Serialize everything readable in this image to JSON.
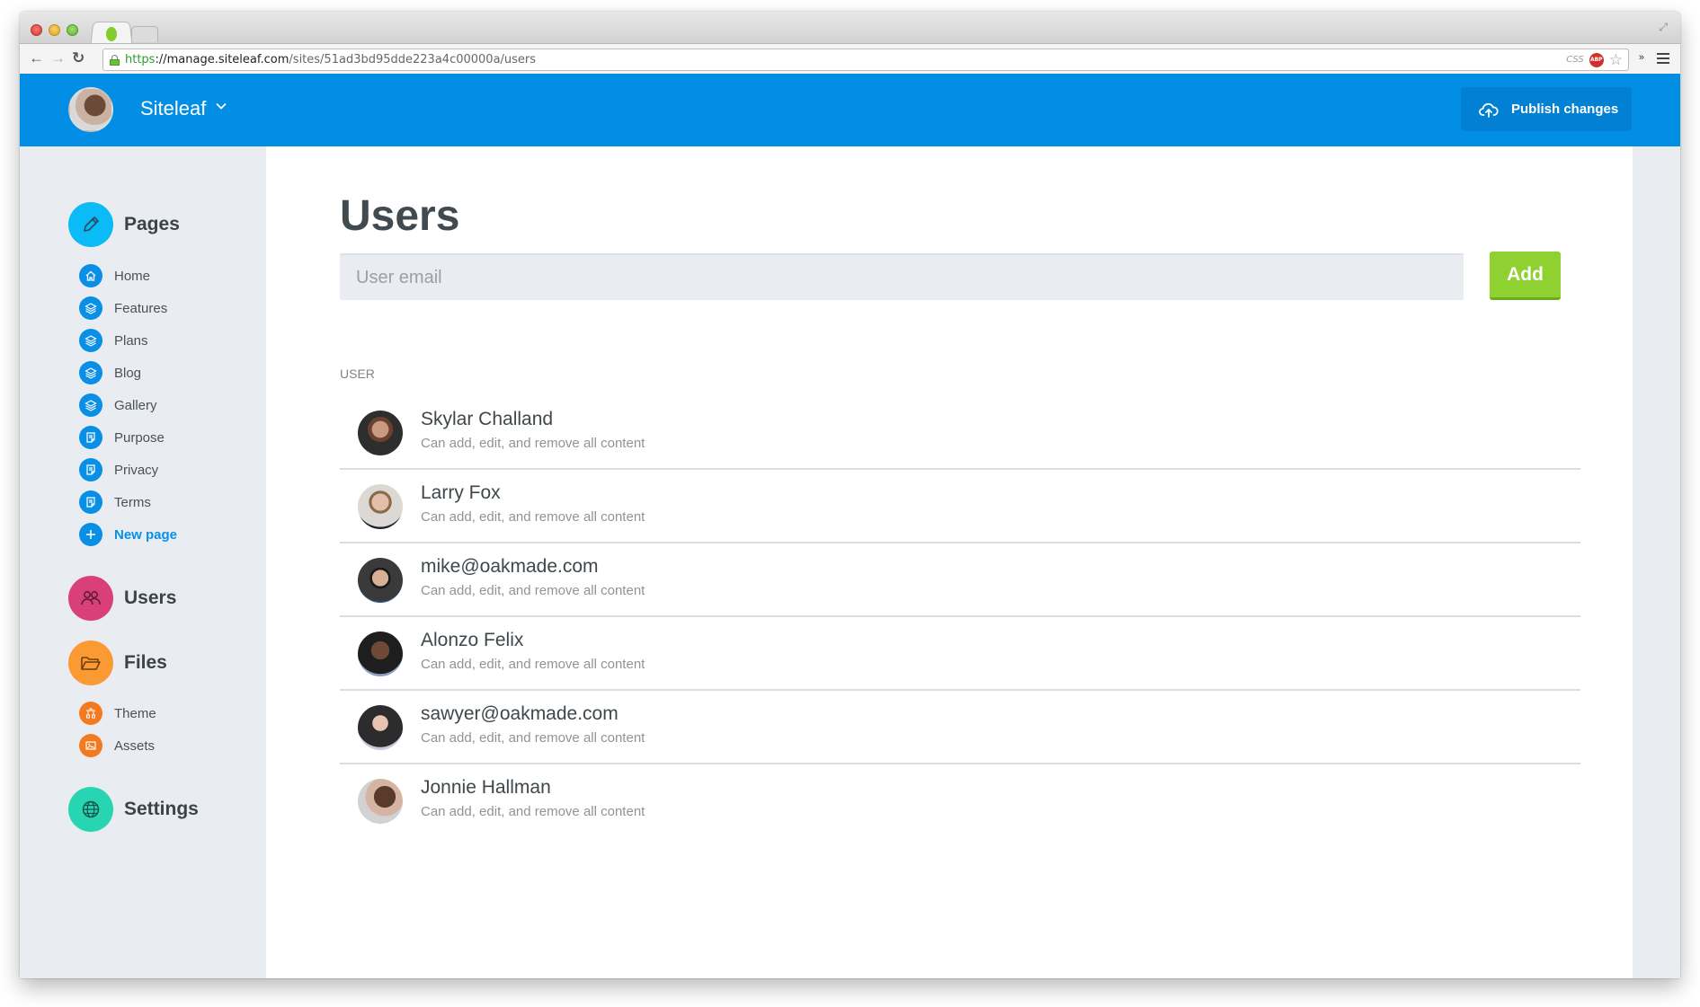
{
  "browser": {
    "url_scheme": "https",
    "url_host": "://manage.siteleaf.com",
    "url_path": "/sites/51ad3bd95dde223a4c00000a/users",
    "extension_css_label": "CSS",
    "extension_abp_label": "ABP"
  },
  "header": {
    "site_name": "Siteleaf",
    "publish_label": "Publish changes",
    "colors": {
      "header_bg": "#038ee6",
      "publish_bg": "#0280d4"
    }
  },
  "sidebar": {
    "sections": [
      {
        "label": "Pages",
        "icon": "pencil-icon",
        "color": "#0abbf7"
      },
      {
        "label": "Users",
        "icon": "users-icon",
        "color": "#d9407a"
      },
      {
        "label": "Files",
        "icon": "folder-icon",
        "color": "#fb9a32"
      },
      {
        "label": "Settings",
        "icon": "globe-icon",
        "color": "#27d5b3"
      }
    ],
    "pages": [
      {
        "label": "Home",
        "icon": "home-icon"
      },
      {
        "label": "Features",
        "icon": "layers-icon"
      },
      {
        "label": "Plans",
        "icon": "layers-icon"
      },
      {
        "label": "Blog",
        "icon": "layers-icon"
      },
      {
        "label": "Gallery",
        "icon": "layers-icon"
      },
      {
        "label": "Purpose",
        "icon": "document-icon"
      },
      {
        "label": "Privacy",
        "icon": "document-icon"
      },
      {
        "label": "Terms",
        "icon": "document-icon"
      }
    ],
    "new_page_label": "New page",
    "files": [
      {
        "label": "Theme",
        "icon": "theme-icon"
      },
      {
        "label": "Assets",
        "icon": "image-icon"
      }
    ]
  },
  "main": {
    "title": "Users",
    "email_placeholder": "User email",
    "email_value": "",
    "add_label": "Add",
    "column_header": "USER",
    "users": [
      {
        "name": "Skylar Challand",
        "role": "Can add, edit, and remove all content"
      },
      {
        "name": "Larry Fox",
        "role": "Can add, edit, and remove all content"
      },
      {
        "name": "mike@oakmade.com",
        "role": "Can add, edit, and remove all content"
      },
      {
        "name": "Alonzo Felix",
        "role": "Can add, edit, and remove all content"
      },
      {
        "name": "sawyer@oakmade.com",
        "role": "Can add, edit, and remove all content"
      },
      {
        "name": "Jonnie Hallman",
        "role": "Can add, edit, and remove all content"
      }
    ]
  }
}
